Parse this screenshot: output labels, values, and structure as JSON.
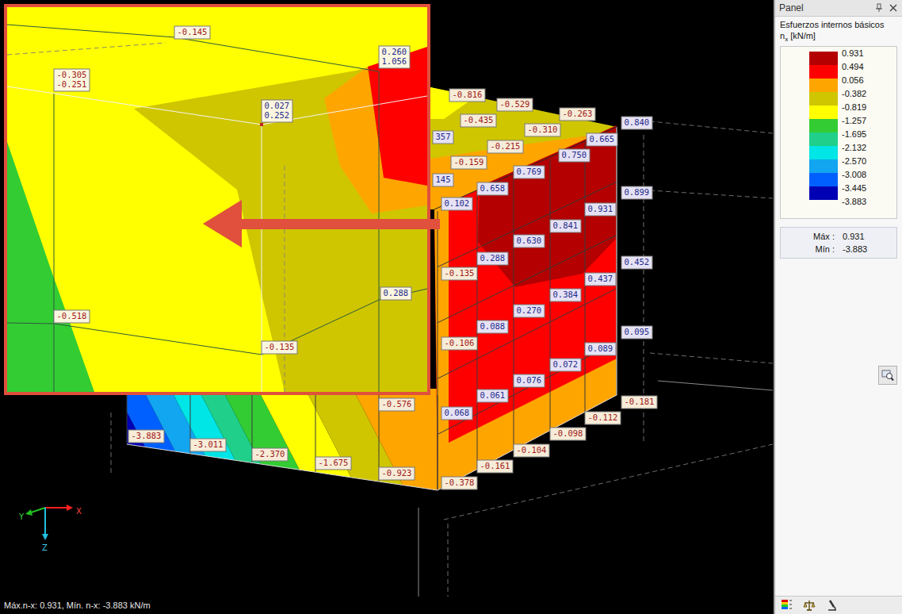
{
  "viewport": {
    "labels": [
      {
        "lines": [
          "-0.816"
        ]
      },
      {
        "lines": [
          "-0.529"
        ]
      },
      {
        "lines": [
          "-0.263"
        ]
      },
      {
        "lines": [
          "0.840"
        ]
      },
      {
        "lines": [
          "-0.435"
        ]
      },
      {
        "lines": [
          "-0.310"
        ]
      },
      {
        "lines": [
          "0.665"
        ]
      },
      {
        "lines": [
          "357"
        ]
      },
      {
        "lines": [
          "-0.215"
        ]
      },
      {
        "lines": [
          "0.750"
        ]
      },
      {
        "lines": [
          "-0.159"
        ]
      },
      {
        "lines": [
          "0.769"
        ]
      },
      {
        "lines": [
          "145"
        ]
      },
      {
        "lines": [
          "0.899"
        ]
      },
      {
        "lines": [
          "0.658"
        ]
      },
      {
        "lines": [
          "0.102"
        ]
      },
      {
        "lines": [
          "0.931"
        ]
      },
      {
        "lines": [
          "0.841"
        ]
      },
      {
        "lines": [
          "0.630"
        ]
      },
      {
        "lines": [
          "0.452"
        ]
      },
      {
        "lines": [
          "0.288"
        ]
      },
      {
        "lines": [
          "-0.135"
        ]
      },
      {
        "lines": [
          "0.437"
        ]
      },
      {
        "lines": [
          "0.384"
        ]
      },
      {
        "lines": [
          "0.270"
        ]
      },
      {
        "lines": [
          "0.095"
        ]
      },
      {
        "lines": [
          "0.088"
        ]
      },
      {
        "lines": [
          "-0.106"
        ]
      },
      {
        "lines": [
          "0.089"
        ]
      },
      {
        "lines": [
          "0.072"
        ]
      },
      {
        "lines": [
          "0.076"
        ]
      },
      {
        "lines": [
          "-0.181"
        ]
      },
      {
        "lines": [
          "0.061"
        ]
      },
      {
        "lines": [
          "0.068"
        ]
      },
      {
        "lines": [
          "-0.112"
        ]
      },
      {
        "lines": [
          "-0.098"
        ]
      },
      {
        "lines": [
          "-0.104"
        ]
      },
      {
        "lines": [
          "-0.576"
        ]
      },
      {
        "lines": [
          "-0.161"
        ]
      },
      {
        "lines": [
          "-0.378"
        ]
      },
      {
        "lines": [
          "-0.923"
        ]
      },
      {
        "lines": [
          "-1.675"
        ]
      },
      {
        "lines": [
          "-2.370"
        ]
      },
      {
        "lines": [
          "-3.011"
        ]
      },
      {
        "lines": [
          "-3.883"
        ]
      }
    ],
    "inset_labels": [
      {
        "lines": [
          "-0.145"
        ]
      },
      {
        "lines": [
          "-0.305",
          "-0.251"
        ]
      },
      {
        "lines": [
          "0.260",
          "1.056"
        ]
      },
      {
        "lines": [
          "0.027",
          "0.252"
        ]
      },
      {
        "lines": [
          "0.288"
        ]
      },
      {
        "lines": [
          "-0.518"
        ]
      },
      {
        "lines": [
          "-0.135"
        ]
      }
    ],
    "axes": {
      "x": "X",
      "y": "Y",
      "z": "Z"
    },
    "status_bar": "Máx.n-x: 0.931, Mín. n-x: -3.883 kN/m"
  },
  "panel": {
    "title": "Panel",
    "heading": "Esfuerzos internos básicos",
    "quantity": {
      "symbol": "n",
      "subscript": "x",
      "unit": "[kN/m]"
    },
    "legend": [
      {
        "value": "0.931",
        "color": "#b40000"
      },
      {
        "value": "0.494",
        "color": "#ff0000"
      },
      {
        "value": "0.056",
        "color": "#ffa500"
      },
      {
        "value": "-0.382",
        "color": "#cfc600"
      },
      {
        "value": "-0.819",
        "color": "#ffff00"
      },
      {
        "value": "-1.257",
        "color": "#33cc33"
      },
      {
        "value": "-1.695",
        "color": "#1fcf8a"
      },
      {
        "value": "-2.132",
        "color": "#00e5e5"
      },
      {
        "value": "-2.570",
        "color": "#12a5f0"
      },
      {
        "value": "-3.008",
        "color": "#0060ff"
      },
      {
        "value": "-3.445",
        "color": "#0000b4"
      },
      {
        "value": "-3.883"
      }
    ],
    "summary": [
      {
        "label": "Máx :",
        "value": "0.931"
      },
      {
        "label": "Mín :",
        "value": "-3.883"
      }
    ]
  }
}
